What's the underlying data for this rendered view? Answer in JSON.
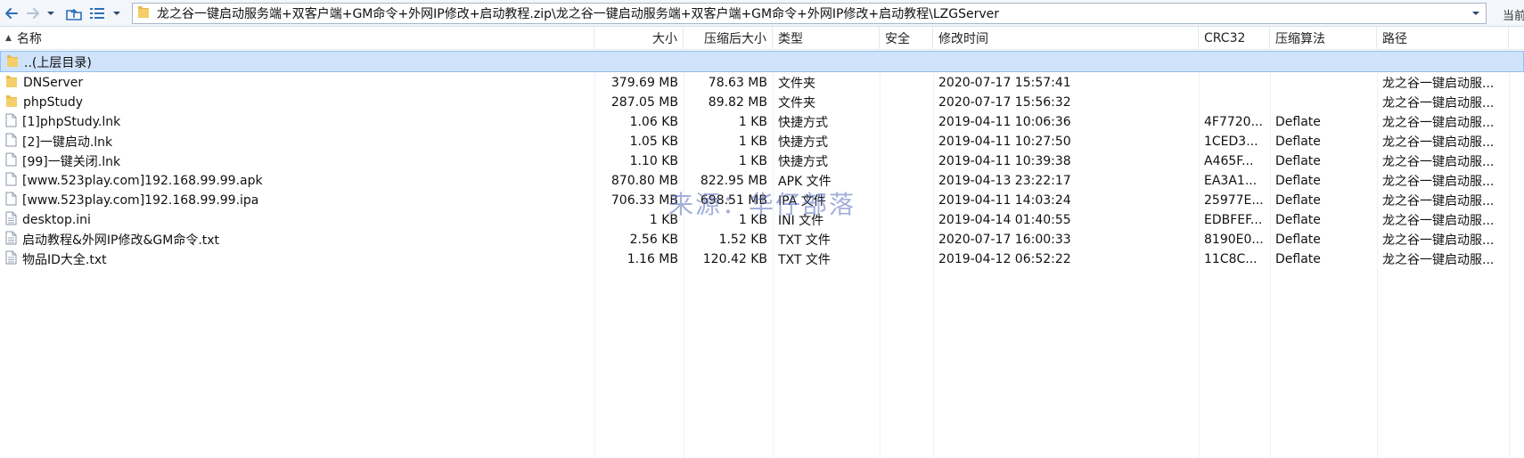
{
  "toolbar": {
    "icons": [
      "back-arrow-icon",
      "forward-arrow-icon",
      "dropdown-icon",
      "up-folder-icon",
      "view-list-icon",
      "dropdown-icon"
    ]
  },
  "address": {
    "path": "龙之谷一键启动服务端+双客户端+GM命令+外网IP修改+启动教程.zip\\龙之谷一键启动服务端+双客户端+GM命令+外网IP修改+启动教程\\LZGServer",
    "current_label": "当前"
  },
  "columns": {
    "name": "名称",
    "size": "大小",
    "packed": "压缩后大小",
    "type": "类型",
    "security": "安全",
    "modified": "修改时间",
    "crc": "CRC32",
    "method": "压缩算法",
    "path": "路径"
  },
  "parent_row": {
    "name": "..(上层目录)"
  },
  "files": [
    {
      "name": "DNServer",
      "size": "379.69 MB",
      "packed": "78.63 MB",
      "type": "文件夹",
      "modified": "2020-07-17 15:57:41",
      "crc": "",
      "method": "",
      "path": "龙之谷一键启动服...",
      "icon": "folder-icon"
    },
    {
      "name": "phpStudy",
      "size": "287.05 MB",
      "packed": "89.82 MB",
      "type": "文件夹",
      "modified": "2020-07-17 15:56:32",
      "crc": "",
      "method": "",
      "path": "龙之谷一键启动服...",
      "icon": "folder-icon"
    },
    {
      "name": "[1]phpStudy.lnk",
      "size": "1.06 KB",
      "packed": "1 KB",
      "type": "快捷方式",
      "modified": "2019-04-11 10:06:36",
      "crc": "4F7720...",
      "method": "Deflate",
      "path": "龙之谷一键启动服...",
      "icon": "file-icon"
    },
    {
      "name": "[2]一键启动.lnk",
      "size": "1.05 KB",
      "packed": "1 KB",
      "type": "快捷方式",
      "modified": "2019-04-11 10:27:50",
      "crc": "1CED3...",
      "method": "Deflate",
      "path": "龙之谷一键启动服...",
      "icon": "file-icon"
    },
    {
      "name": "[99]一键关闭.lnk",
      "size": "1.10 KB",
      "packed": "1 KB",
      "type": "快捷方式",
      "modified": "2019-04-11 10:39:38",
      "crc": "A465F...",
      "method": "Deflate",
      "path": "龙之谷一键启动服...",
      "icon": "file-icon"
    },
    {
      "name": "[www.523play.com]192.168.99.99.apk",
      "size": "870.80 MB",
      "packed": "822.95 MB",
      "type": "APK 文件",
      "modified": "2019-04-13 23:22:17",
      "crc": "EA3A1...",
      "method": "Deflate",
      "path": "龙之谷一键启动服...",
      "icon": "file-icon"
    },
    {
      "name": "[www.523play.com]192.168.99.99.ipa",
      "size": "706.33 MB",
      "packed": "698.51 MB",
      "type": "IPA 文件",
      "modified": "2019-04-11 14:03:24",
      "crc": "25977E...",
      "method": "Deflate",
      "path": "龙之谷一键启动服...",
      "icon": "file-icon"
    },
    {
      "name": "desktop.ini",
      "size": "1 KB",
      "packed": "1 KB",
      "type": "INI 文件",
      "modified": "2019-04-14 01:40:55",
      "crc": "EDBFEF...",
      "method": "Deflate",
      "path": "龙之谷一键启动服...",
      "icon": "text-file-icon"
    },
    {
      "name": "启动教程&外网IP修改&GM命令.txt",
      "size": "2.56 KB",
      "packed": "1.52 KB",
      "type": "TXT 文件",
      "modified": "2020-07-17 16:00:33",
      "crc": "8190E0...",
      "method": "Deflate",
      "path": "龙之谷一键启动服...",
      "icon": "text-file-icon"
    },
    {
      "name": "物品ID大全.txt",
      "size": "1.16 MB",
      "packed": "120.42 KB",
      "type": "TXT 文件",
      "modified": "2019-04-12 06:52:22",
      "crc": "11C8C...",
      "method": "Deflate",
      "path": "龙之谷一键启动服...",
      "icon": "text-file-icon"
    }
  ],
  "watermark": "来源：华仔部落",
  "colors": {
    "folder": "#e8b84a",
    "toolbar_icon": "#2d6fb5",
    "selection": "#cfe3fb"
  }
}
